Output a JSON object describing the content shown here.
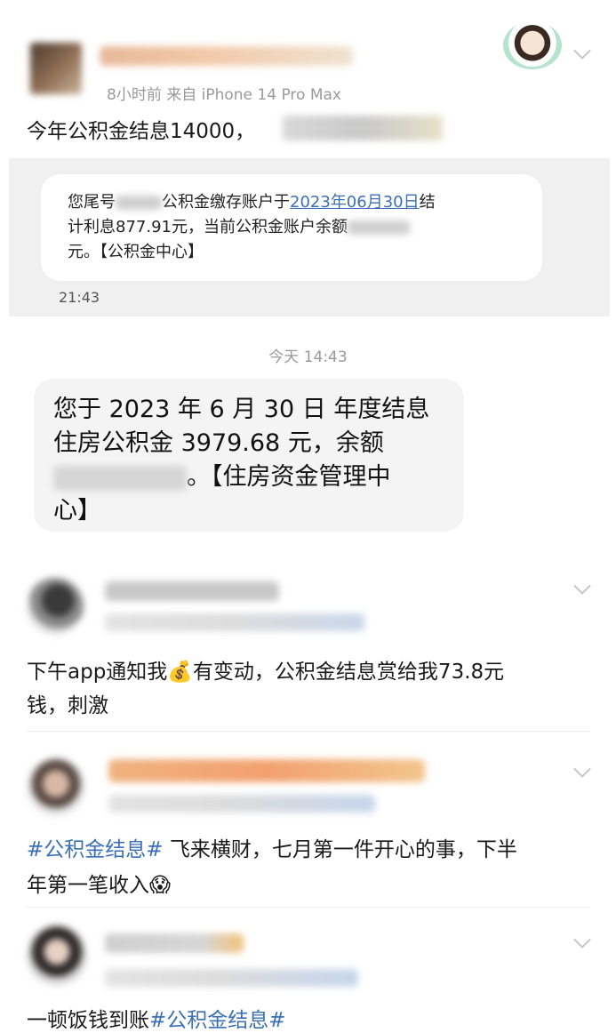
{
  "post_header": {
    "meta_text": "8小时前  来自 iPhone 14 Pro Max",
    "content_prefix": "今年公积金结息14000，"
  },
  "sms_card": {
    "prefix": "您尾号",
    "mid_1": "公积金缴存账户于",
    "date_link": "2023年06月30日",
    "mid_2": "结",
    "line_2_prefix": "计利息877.91元，当前公积金账户余额",
    "line_3": "元。【公积金中心】",
    "time": "21:43"
  },
  "chat": {
    "date_label": "今天 14:43",
    "line_1": "您于 2023 年 6 月 30 日 年度结息",
    "line_2": "住房公积金 3979.68 元，余额",
    "line_3_suffix": "。【住房资金管理中",
    "line_4": "心】"
  },
  "comments": [
    {
      "line_1": "下午app通知我💰有变动，公积金结息赏给我73.8元",
      "line_2": "钱，刺激"
    },
    {
      "topic": "#公积金结息#",
      "line_1_rest": " 飞来横财，七月第一件开心的事，下半",
      "line_2": "年第一笔收入😱"
    },
    {
      "text_prefix": "一顿饭钱到账",
      "topic": "#公积金结息#"
    }
  ],
  "colors": {
    "link_blue": "#3b6fb6",
    "sms_bg": "#f0f0f0",
    "chat_bubble_bg": "#f4f4f4"
  }
}
